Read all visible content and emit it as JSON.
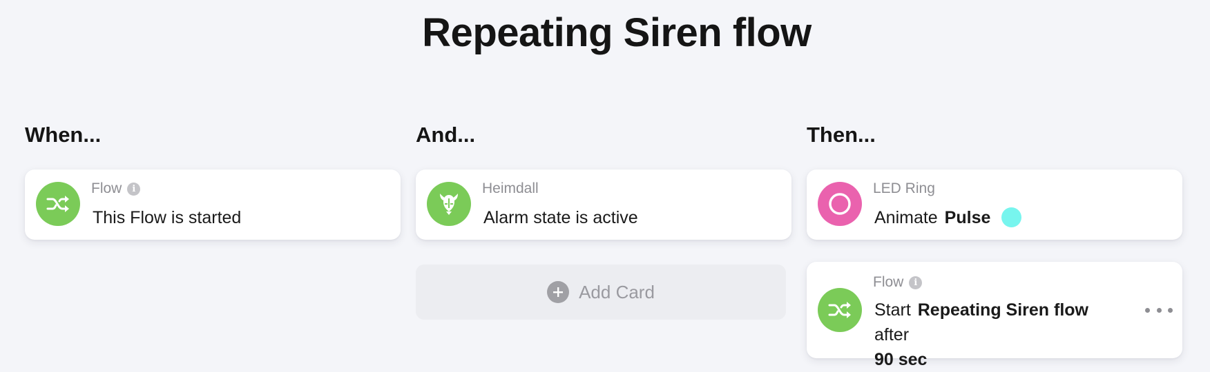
{
  "page": {
    "title": "Repeating Siren flow"
  },
  "columns": {
    "when": {
      "heading": "When...",
      "cards": [
        {
          "source": "Flow",
          "icon": "flow-shuffle-icon",
          "icon_color": "#7bcb58",
          "text": "This Flow is started",
          "has_info": true
        }
      ]
    },
    "and": {
      "heading": "And...",
      "cards": [
        {
          "source": "Heimdall",
          "icon": "heimdall-helmet-icon",
          "icon_color": "#7bcb58",
          "text": "Alarm state is active"
        }
      ],
      "add_card_label": "Add Card"
    },
    "then": {
      "heading": "Then...",
      "cards": [
        {
          "source": "LED Ring",
          "icon": "led-ring-icon",
          "icon_color": "#ea62ae",
          "text_prefix": "Animate",
          "arg_animation": "Pulse",
          "arg_color": "#77f5ee"
        },
        {
          "source": "Flow",
          "icon": "flow-shuffle-icon",
          "icon_color": "#7bcb58",
          "has_info": true,
          "text_prefix": "Start",
          "arg_flow": "Repeating Siren flow",
          "text_middle": "after",
          "arg_delay": "90 sec"
        }
      ]
    }
  },
  "colors": {
    "background": "#f4f5f9",
    "card": "#ffffff",
    "green": "#7bcb58",
    "pink": "#ea62ae",
    "cyan": "#77f5ee"
  }
}
